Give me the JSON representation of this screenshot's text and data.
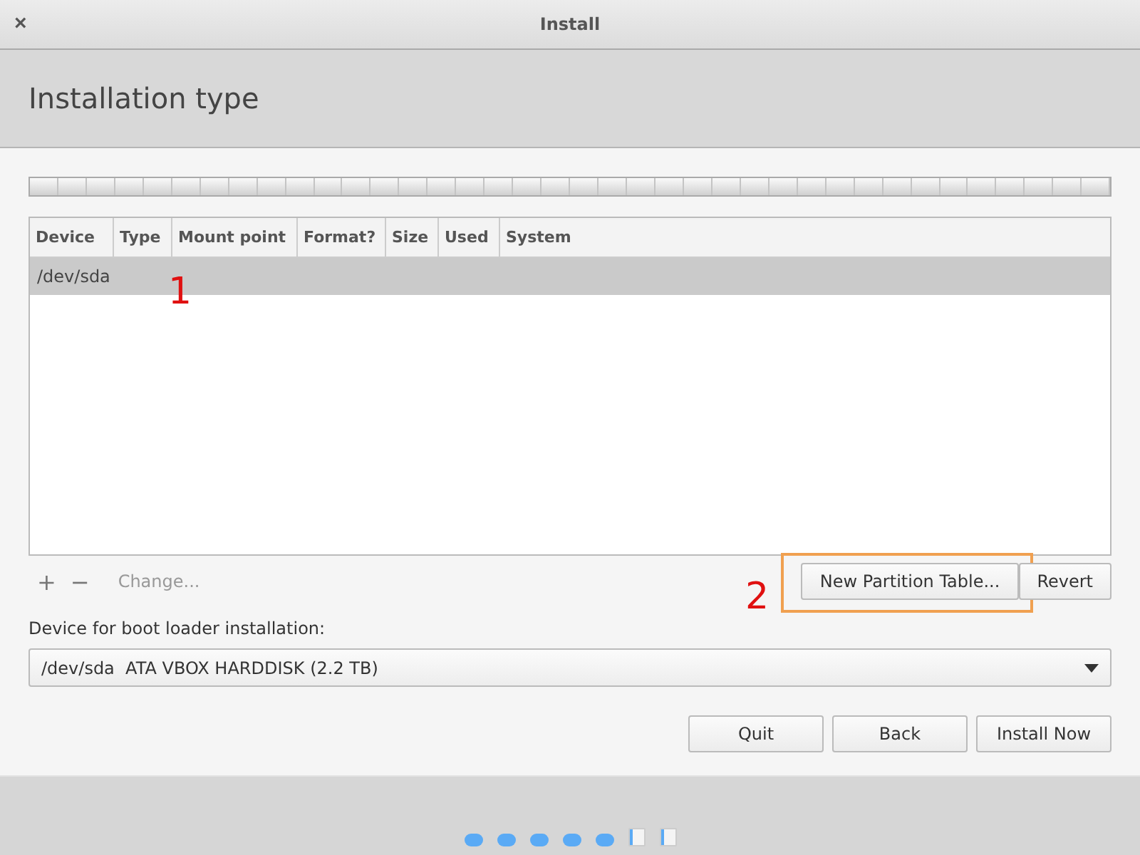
{
  "window": {
    "title": "Install",
    "close": "×"
  },
  "header": {
    "title": "Installation type"
  },
  "table": {
    "columns": [
      "Device",
      "Type",
      "Mount point",
      "Format?",
      "Size",
      "Used",
      "System"
    ],
    "rows": [
      {
        "cells": [
          "/dev/sda",
          "",
          "",
          "",
          "",
          "",
          ""
        ],
        "selected": true
      }
    ]
  },
  "toolbar": {
    "add": "+",
    "remove": "−",
    "change": {
      "label": "Change...",
      "disabled": true
    }
  },
  "partition_buttons": [
    {
      "label": "New Partition Table...",
      "highlighted": true
    },
    {
      "label": "Revert",
      "highlighted": false
    }
  ],
  "boot_loader": {
    "label": "Device for boot loader installation:",
    "value": "/dev/sda  ATA VBOX HARDDISK (2.2 TB)"
  },
  "buttons": [
    "Quit",
    "Back",
    "Install Now"
  ],
  "steps": [
    {
      "done": true
    },
    {
      "done": true
    },
    {
      "done": true
    },
    {
      "done": true
    },
    {
      "done": true
    },
    {
      "done": false
    },
    {
      "done": false
    }
  ],
  "annotations": [
    "1",
    "2"
  ]
}
